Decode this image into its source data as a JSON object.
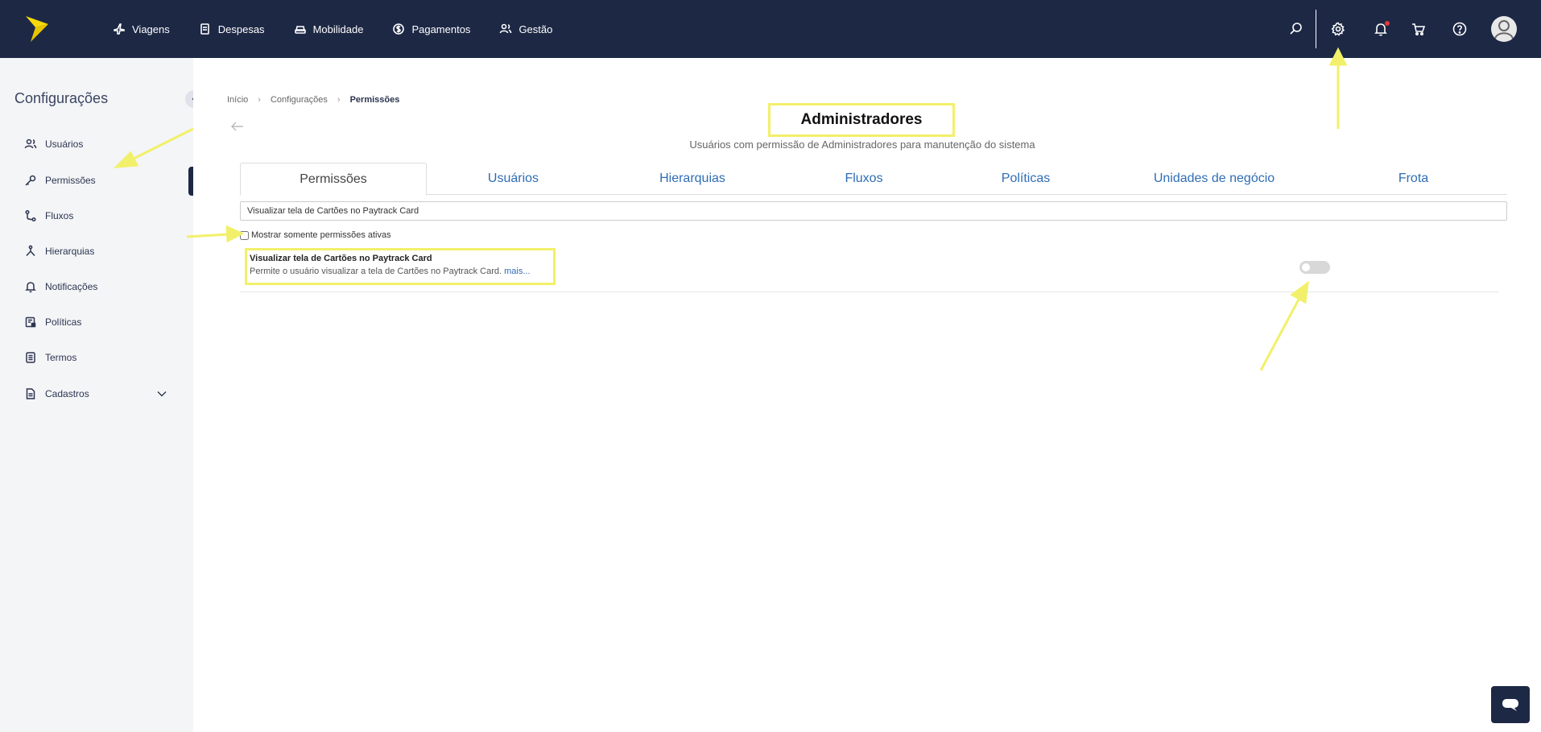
{
  "nav": {
    "items": [
      {
        "label": "Viagens",
        "icon": "airplane-icon"
      },
      {
        "label": "Despesas",
        "icon": "receipt-icon"
      },
      {
        "label": "Mobilidade",
        "icon": "car-icon"
      },
      {
        "label": "Pagamentos",
        "icon": "dollar-icon"
      },
      {
        "label": "Gestão",
        "icon": "users-icon"
      }
    ]
  },
  "sidebar": {
    "title": "Configurações",
    "items": [
      {
        "label": "Usuários",
        "icon": "users-icon"
      },
      {
        "label": "Permissões",
        "icon": "key-icon"
      },
      {
        "label": "Fluxos",
        "icon": "flow-icon"
      },
      {
        "label": "Hierarquias",
        "icon": "hierarchy-icon"
      },
      {
        "label": "Notificações",
        "icon": "bell-icon"
      },
      {
        "label": "Políticas",
        "icon": "policy-icon"
      },
      {
        "label": "Termos",
        "icon": "document-icon"
      },
      {
        "label": "Cadastros",
        "icon": "file-icon"
      }
    ]
  },
  "breadcrumb": {
    "items": [
      "Início",
      "Configurações",
      "Permissões"
    ]
  },
  "page": {
    "title": "Administradores",
    "subtitle": "Usuários com permissão de Administradores para manutenção do sistema"
  },
  "tabs": [
    {
      "label": "Permissões",
      "active": true
    },
    {
      "label": "Usuários",
      "active": false
    },
    {
      "label": "Hierarquias",
      "active": false
    },
    {
      "label": "Fluxos",
      "active": false
    },
    {
      "label": "Políticas",
      "active": false
    },
    {
      "label": "Unidades de negócio",
      "active": false
    },
    {
      "label": "Frota",
      "active": false
    }
  ],
  "search": {
    "value": "Visualizar tela de Cartões no Paytrack Card"
  },
  "filter": {
    "checkbox_label": "Mostrar somente permissões ativas",
    "checked": false
  },
  "permission": {
    "title": "Visualizar tela de Cartões no Paytrack Card",
    "description": "Permite o usuário visualizar a tela de Cartões no Paytrack Card.",
    "more_label": "mais...",
    "enabled": false
  },
  "colors": {
    "topbar": "#1d2845",
    "logo": "#f5d90a",
    "link": "#2f6db5",
    "highlight": "#f2f06a",
    "notification_dot": "#e53935"
  }
}
